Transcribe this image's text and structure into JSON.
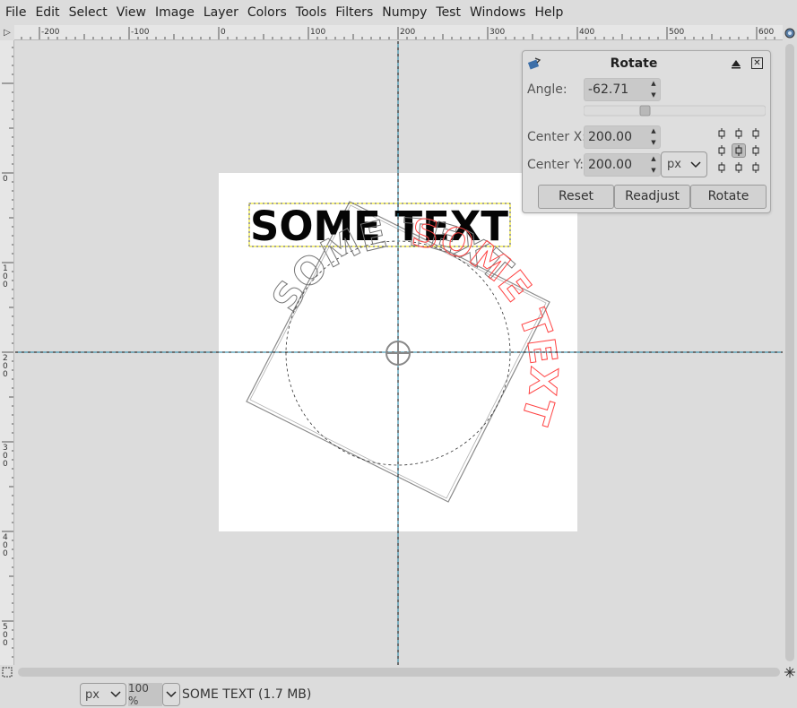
{
  "menubar": {
    "items": [
      "File",
      "Edit",
      "Select",
      "View",
      "Image",
      "Layer",
      "Colors",
      "Tools",
      "Filters",
      "Numpy",
      "Test",
      "Windows",
      "Help"
    ]
  },
  "rulers": {
    "horizontal_labels": [
      "-200",
      "-100",
      "0",
      "100",
      "200",
      "300",
      "400",
      "500",
      "600"
    ],
    "vertical_labels": [
      "0",
      "100",
      "200",
      "300",
      "400",
      "500"
    ]
  },
  "canvas": {
    "layer_text": "SOME TEXT"
  },
  "rotate_dialog": {
    "title": "Rotate",
    "angle_label": "Angle:",
    "angle_value": "-62.71",
    "angle_slider_fraction": 0.33,
    "center_x_label": "Center X:",
    "center_x_value": "200.00",
    "center_y_label": "Center Y:",
    "center_y_value": "200.00",
    "unit": "px",
    "reset_label": "Reset",
    "readjust_label": "Readjust",
    "rotate_label": "Rotate"
  },
  "statusbar": {
    "unit": "px",
    "zoom": "100 %",
    "layer_info": "SOME TEXT (1.7 MB)"
  },
  "colors": {
    "guide": "#1a7fa0",
    "preview_outline": "#ff4444",
    "frame": "#8a8a8a"
  }
}
